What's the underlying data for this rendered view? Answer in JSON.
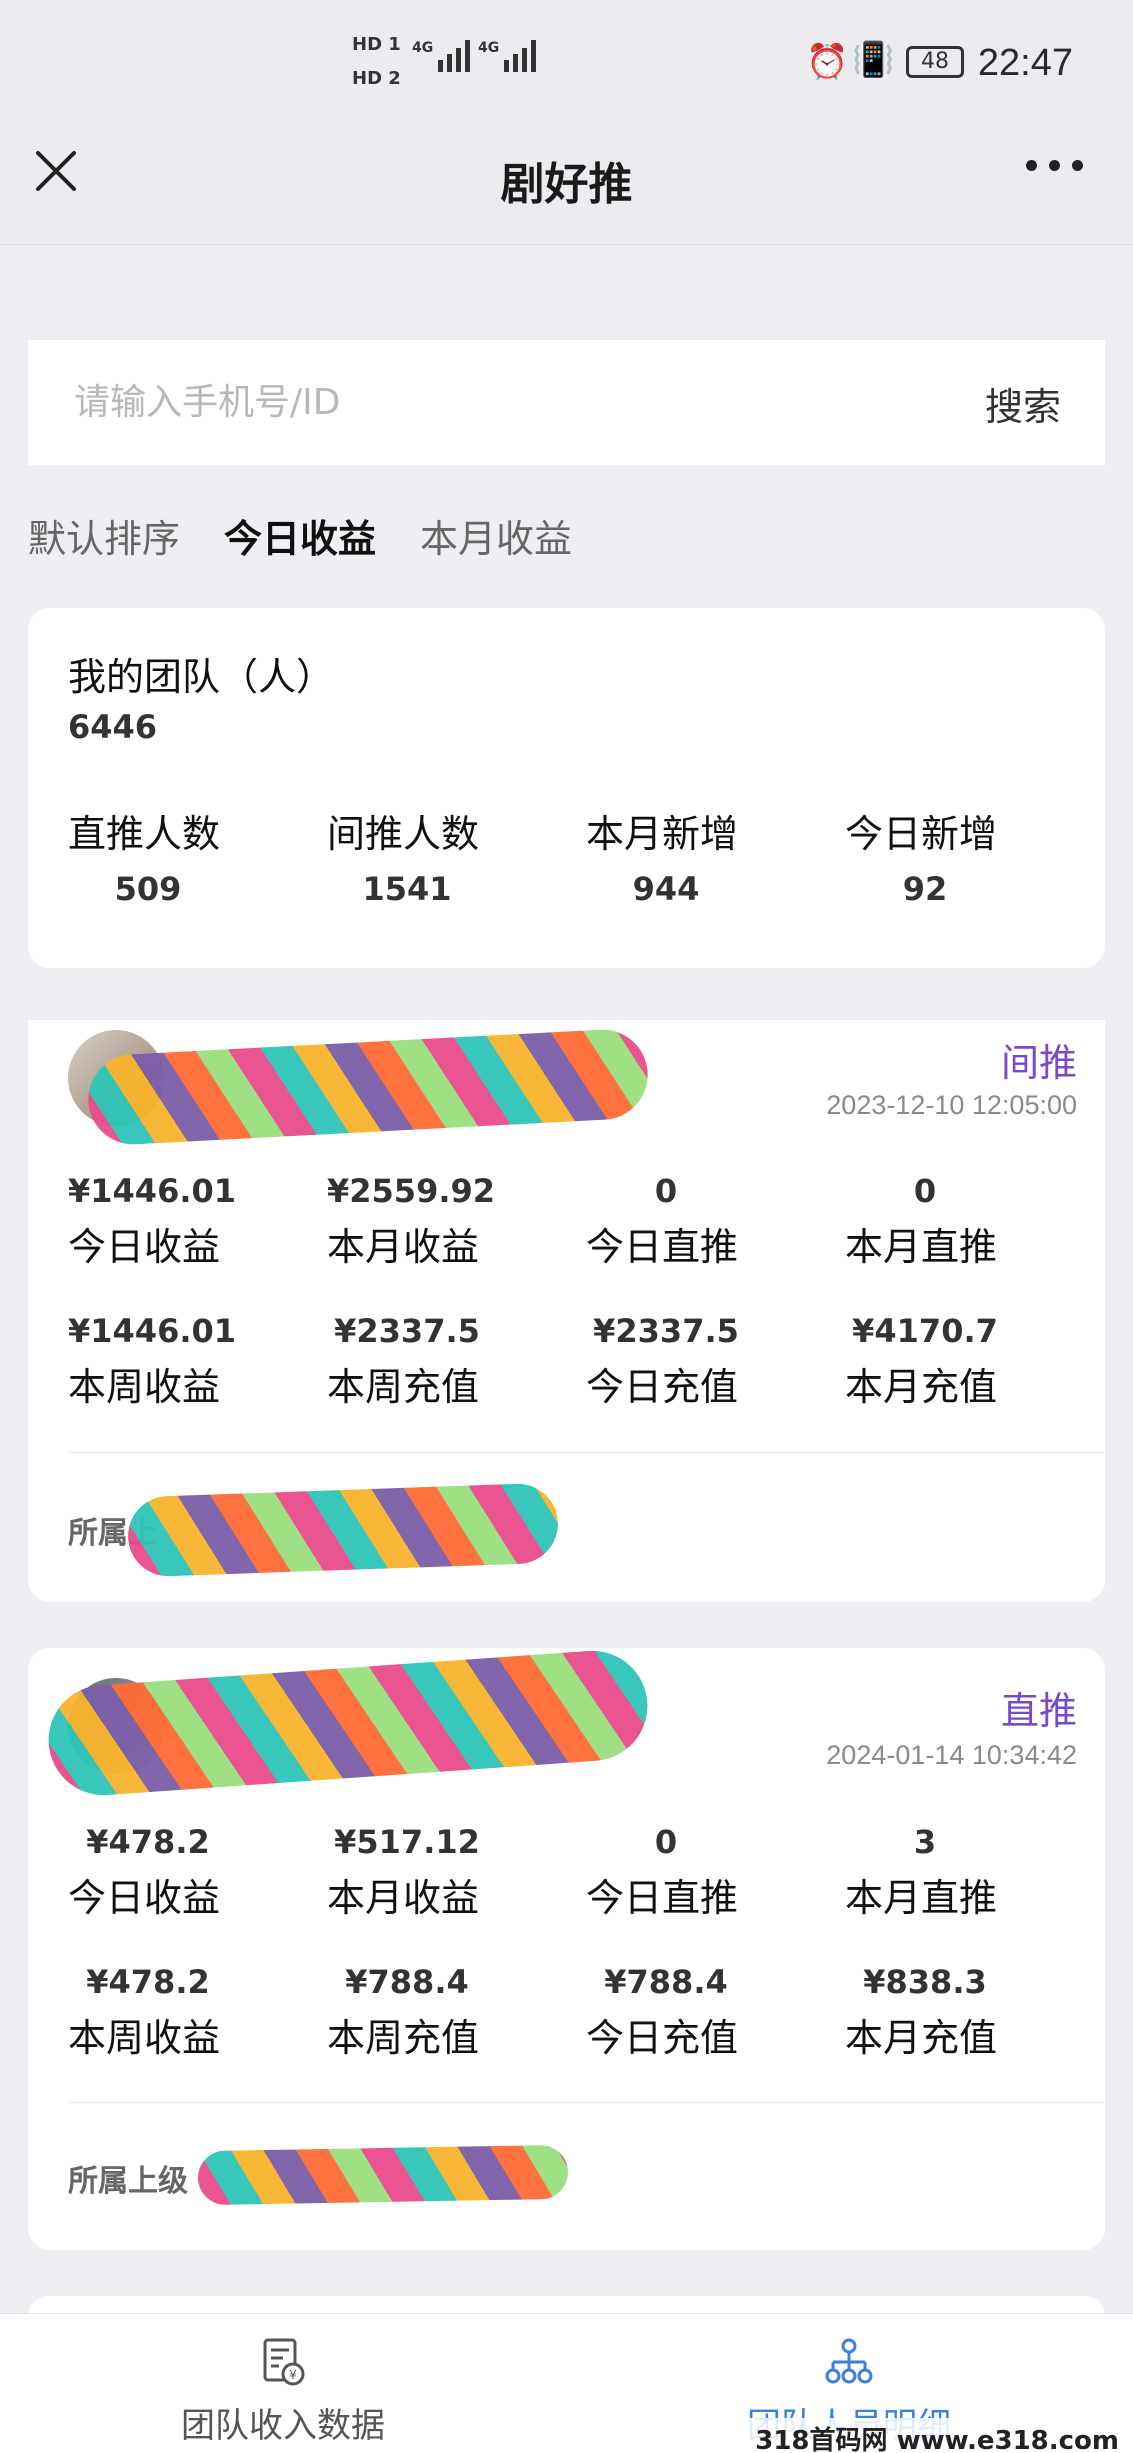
{
  "status_bar": {
    "sim1": "HD 1",
    "sim2": "HD 2",
    "net1": "4G",
    "net2": "4G",
    "battery": "48",
    "time": "22:47"
  },
  "header": {
    "title": "剧好推"
  },
  "search": {
    "placeholder": "请输入手机号/ID",
    "button": "搜索"
  },
  "sort_tabs": [
    {
      "label": "默认排序",
      "active": false
    },
    {
      "label": "今日收益",
      "active": true
    },
    {
      "label": "本月收益",
      "active": false
    }
  ],
  "team": {
    "title": "我的团队（人）",
    "total": "6446",
    "stats": [
      {
        "label": "直推人数",
        "value": "509"
      },
      {
        "label": "间推人数",
        "value": "1541"
      },
      {
        "label": "本月新增",
        "value": "944"
      },
      {
        "label": "今日新增",
        "value": "92"
      }
    ]
  },
  "members": [
    {
      "type": "间推",
      "date": "2023-12-10 12:05:00",
      "row1": [
        {
          "value": "¥1446.01",
          "label": "今日收益"
        },
        {
          "value": "¥2559.92",
          "label": "本月收益"
        },
        {
          "value": "0",
          "label": "今日直推"
        },
        {
          "value": "0",
          "label": "本月直推"
        }
      ],
      "row2": [
        {
          "value": "¥1446.01",
          "label": "本周收益"
        },
        {
          "value": "¥2337.5",
          "label": "本周充值"
        },
        {
          "value": "¥2337.5",
          "label": "今日充值"
        },
        {
          "value": "¥4170.7",
          "label": "本月充值"
        }
      ],
      "parent_label": "所属上"
    },
    {
      "type": "直推",
      "date": "2024-01-14 10:34:42",
      "row1": [
        {
          "value": "¥478.2",
          "label": "今日收益"
        },
        {
          "value": "¥517.12",
          "label": "本月收益"
        },
        {
          "value": "0",
          "label": "今日直推"
        },
        {
          "value": "3",
          "label": "本月直推"
        }
      ],
      "row2": [
        {
          "value": "¥478.2",
          "label": "本周收益"
        },
        {
          "value": "¥788.4",
          "label": "本周充值"
        },
        {
          "value": "¥788.4",
          "label": "今日充值"
        },
        {
          "value": "¥838.3",
          "label": "本月充值"
        }
      ],
      "parent_label": "所属上级"
    }
  ],
  "bottom_nav": [
    {
      "label": "团队收入数据",
      "icon": "income-document-icon",
      "active": false
    },
    {
      "label": "团队人员明细",
      "icon": "org-tree-icon",
      "active": true
    }
  ],
  "watermark": "318首码网 www.e318.com",
  "colors": {
    "accent_purple": "#7a48c9",
    "active_blue": "#3b7fe0",
    "background": "#efeff3"
  }
}
